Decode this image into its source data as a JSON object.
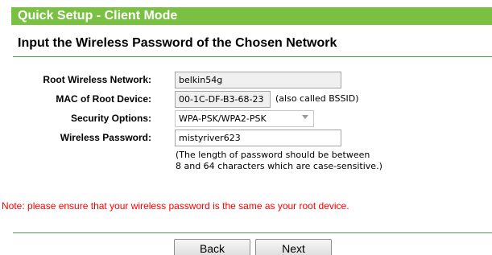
{
  "header": {
    "title": "Quick Setup - Client Mode"
  },
  "subtitle": "Input the Wireless Password of the Chosen Network",
  "form": {
    "root_network": {
      "label": "Root Wireless Network:",
      "value": "belkin54g"
    },
    "mac": {
      "label": "MAC of Root Device:",
      "value": "00-1C-DF-B3-68-23",
      "hint": "(also called BSSID)"
    },
    "security": {
      "label": "Security Options:",
      "value": "WPA-PSK/WPA2-PSK"
    },
    "password": {
      "label": "Wireless Password:",
      "value": "mistyriver623",
      "help_line1": "(The length of password should be between",
      "help_line2": "8 and 64 characters which are case-sensitive.)"
    }
  },
  "note": "Note: please ensure that your wireless password is the same as your root device.",
  "buttons": {
    "back": "Back",
    "next": "Next"
  },
  "colors": {
    "header_bar": "#7ac143",
    "divider": "#4d9b4d",
    "note_text": "#ff0000"
  },
  "icons": {
    "select_dropdown": "chevron-down-icon"
  }
}
